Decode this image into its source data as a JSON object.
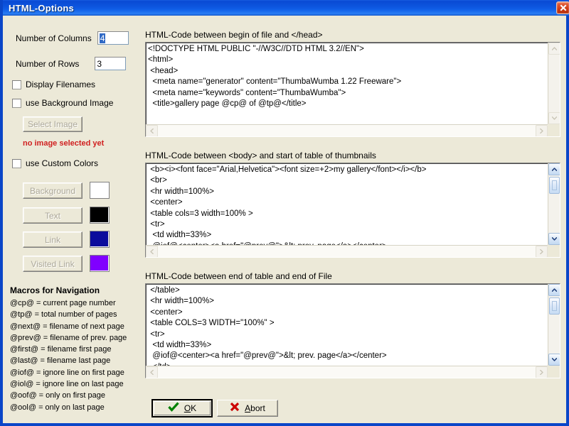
{
  "window": {
    "title": "HTML-Options",
    "close_icon": "close-icon",
    "accent_titlebar": "#0a4ad4",
    "face_color": "#ece9d8"
  },
  "left_panel": {
    "columns": {
      "label": "Number of Columns",
      "value": "4",
      "selected": true
    },
    "rows": {
      "label": "Number of Rows",
      "value": "3",
      "selected": false
    },
    "checkboxes": [
      {
        "label": "Display Filenames",
        "checked": false
      },
      {
        "label": "use Background Image",
        "checked": false
      },
      {
        "label": "use Custom Colors",
        "checked": false
      }
    ],
    "select_image_button": {
      "label": "Select Image",
      "disabled": true
    },
    "no_image_message": "no image selected yet",
    "color_rows": [
      {
        "label": "Background",
        "color": "#ffffff",
        "disabled": true
      },
      {
        "label": "Text",
        "color": "#000000",
        "disabled": true
      },
      {
        "label": "Link",
        "color": "#0c0c9c",
        "disabled": true
      },
      {
        "label": "Visited Link",
        "color": "#8000ff",
        "disabled": true
      }
    ]
  },
  "macros": {
    "title": "Macros for Navigation",
    "lines": [
      "@cp@ = current page number",
      "@tp@ = total number of pages",
      "@next@ = filename of next page",
      "@prev@ = filename of prev. page",
      "@first@ = filename first page",
      "@last@ = filename last page",
      "@iof@ = ignore line on first page",
      "@iol@ = ignore line on last page",
      "@oof@ = only on first page",
      "@ool@ = only on last page"
    ]
  },
  "editors": [
    {
      "label": "HTML-Code between begin of file and </head>",
      "content": "<!DOCTYPE HTML PUBLIC \"-//W3C//DTD HTML 3.2//EN\">\n<html>\n <head>\n  <meta name=\"generator\" content=\"ThumbaWumba 1.22 Freeware\">\n  <meta name=\"keywords\" content=\"ThumbaWumba\">\n  <title>gallery page @cp@ of @tp@</title>",
      "vscroll_enabled": false,
      "hscroll_enabled": false
    },
    {
      "label": "HTML-Code between <body> and start of table of thumbnails",
      "content": " <b><i><font face=\"Arial,Helvetica\"><font size=+2>my gallery</font></i></b>\n <br>\n <hr width=100%>\n <center>\n <table cols=3 width=100% >\n <tr>\n  <td width=33%>\n  @iof@<center><a href=\"@prev@\">&lt; prev. page</a></center>",
      "vscroll_enabled": true,
      "hscroll_enabled": false
    },
    {
      "label": "HTML-Code between end of table and end of File",
      "content": " </table>\n <hr width=100%>\n <center>\n <table COLS=3 WIDTH=\"100%\" >\n <tr>\n  <td width=33%>\n  @iof@<center><a href=\"@prev@\">&lt; prev. page</a></center>\n  </td>",
      "vscroll_enabled": true,
      "hscroll_enabled": false
    }
  ],
  "footer": {
    "ok": {
      "label": "OK",
      "accel": "O",
      "rest": "K",
      "icon": "check-icon",
      "icon_color": "#008000",
      "default": true
    },
    "abort": {
      "label": "Abort",
      "accel": "A",
      "rest": "bort",
      "icon": "cross-icon",
      "icon_color": "#cc0000",
      "default": false
    }
  }
}
